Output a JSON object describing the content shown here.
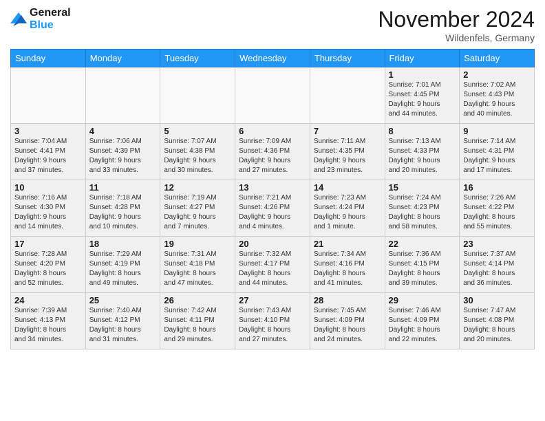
{
  "header": {
    "logo_text1": "General",
    "logo_text2": "Blue",
    "month_title": "November 2024",
    "location": "Wildenfels, Germany"
  },
  "weekdays": [
    "Sunday",
    "Monday",
    "Tuesday",
    "Wednesday",
    "Thursday",
    "Friday",
    "Saturday"
  ],
  "weeks": [
    [
      {
        "day": "",
        "info": "",
        "empty": true
      },
      {
        "day": "",
        "info": "",
        "empty": true
      },
      {
        "day": "",
        "info": "",
        "empty": true
      },
      {
        "day": "",
        "info": "",
        "empty": true
      },
      {
        "day": "",
        "info": "",
        "empty": true
      },
      {
        "day": "1",
        "info": "Sunrise: 7:01 AM\nSunset: 4:45 PM\nDaylight: 9 hours\nand 44 minutes."
      },
      {
        "day": "2",
        "info": "Sunrise: 7:02 AM\nSunset: 4:43 PM\nDaylight: 9 hours\nand 40 minutes."
      }
    ],
    [
      {
        "day": "3",
        "info": "Sunrise: 7:04 AM\nSunset: 4:41 PM\nDaylight: 9 hours\nand 37 minutes."
      },
      {
        "day": "4",
        "info": "Sunrise: 7:06 AM\nSunset: 4:39 PM\nDaylight: 9 hours\nand 33 minutes."
      },
      {
        "day": "5",
        "info": "Sunrise: 7:07 AM\nSunset: 4:38 PM\nDaylight: 9 hours\nand 30 minutes."
      },
      {
        "day": "6",
        "info": "Sunrise: 7:09 AM\nSunset: 4:36 PM\nDaylight: 9 hours\nand 27 minutes."
      },
      {
        "day": "7",
        "info": "Sunrise: 7:11 AM\nSunset: 4:35 PM\nDaylight: 9 hours\nand 23 minutes."
      },
      {
        "day": "8",
        "info": "Sunrise: 7:13 AM\nSunset: 4:33 PM\nDaylight: 9 hours\nand 20 minutes."
      },
      {
        "day": "9",
        "info": "Sunrise: 7:14 AM\nSunset: 4:31 PM\nDaylight: 9 hours\nand 17 minutes."
      }
    ],
    [
      {
        "day": "10",
        "info": "Sunrise: 7:16 AM\nSunset: 4:30 PM\nDaylight: 9 hours\nand 14 minutes."
      },
      {
        "day": "11",
        "info": "Sunrise: 7:18 AM\nSunset: 4:28 PM\nDaylight: 9 hours\nand 10 minutes."
      },
      {
        "day": "12",
        "info": "Sunrise: 7:19 AM\nSunset: 4:27 PM\nDaylight: 9 hours\nand 7 minutes."
      },
      {
        "day": "13",
        "info": "Sunrise: 7:21 AM\nSunset: 4:26 PM\nDaylight: 9 hours\nand 4 minutes."
      },
      {
        "day": "14",
        "info": "Sunrise: 7:23 AM\nSunset: 4:24 PM\nDaylight: 9 hours\nand 1 minute."
      },
      {
        "day": "15",
        "info": "Sunrise: 7:24 AM\nSunset: 4:23 PM\nDaylight: 8 hours\nand 58 minutes."
      },
      {
        "day": "16",
        "info": "Sunrise: 7:26 AM\nSunset: 4:22 PM\nDaylight: 8 hours\nand 55 minutes."
      }
    ],
    [
      {
        "day": "17",
        "info": "Sunrise: 7:28 AM\nSunset: 4:20 PM\nDaylight: 8 hours\nand 52 minutes."
      },
      {
        "day": "18",
        "info": "Sunrise: 7:29 AM\nSunset: 4:19 PM\nDaylight: 8 hours\nand 49 minutes."
      },
      {
        "day": "19",
        "info": "Sunrise: 7:31 AM\nSunset: 4:18 PM\nDaylight: 8 hours\nand 47 minutes."
      },
      {
        "day": "20",
        "info": "Sunrise: 7:32 AM\nSunset: 4:17 PM\nDaylight: 8 hours\nand 44 minutes."
      },
      {
        "day": "21",
        "info": "Sunrise: 7:34 AM\nSunset: 4:16 PM\nDaylight: 8 hours\nand 41 minutes."
      },
      {
        "day": "22",
        "info": "Sunrise: 7:36 AM\nSunset: 4:15 PM\nDaylight: 8 hours\nand 39 minutes."
      },
      {
        "day": "23",
        "info": "Sunrise: 7:37 AM\nSunset: 4:14 PM\nDaylight: 8 hours\nand 36 minutes."
      }
    ],
    [
      {
        "day": "24",
        "info": "Sunrise: 7:39 AM\nSunset: 4:13 PM\nDaylight: 8 hours\nand 34 minutes."
      },
      {
        "day": "25",
        "info": "Sunrise: 7:40 AM\nSunset: 4:12 PM\nDaylight: 8 hours\nand 31 minutes."
      },
      {
        "day": "26",
        "info": "Sunrise: 7:42 AM\nSunset: 4:11 PM\nDaylight: 8 hours\nand 29 minutes."
      },
      {
        "day": "27",
        "info": "Sunrise: 7:43 AM\nSunset: 4:10 PM\nDaylight: 8 hours\nand 27 minutes."
      },
      {
        "day": "28",
        "info": "Sunrise: 7:45 AM\nSunset: 4:09 PM\nDaylight: 8 hours\nand 24 minutes."
      },
      {
        "day": "29",
        "info": "Sunrise: 7:46 AM\nSunset: 4:09 PM\nDaylight: 8 hours\nand 22 minutes."
      },
      {
        "day": "30",
        "info": "Sunrise: 7:47 AM\nSunset: 4:08 PM\nDaylight: 8 hours\nand 20 minutes."
      }
    ]
  ]
}
